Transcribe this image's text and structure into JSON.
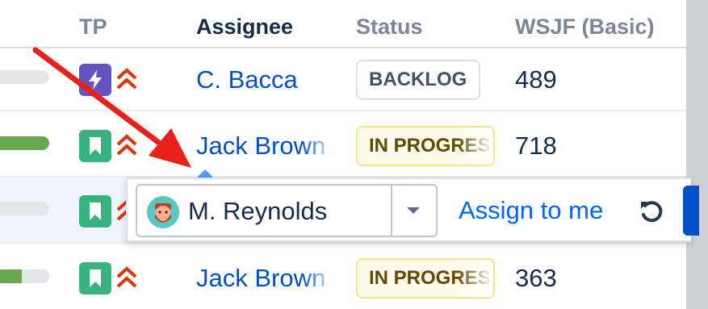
{
  "header": {
    "tp": "TP",
    "assignee": "Assignee",
    "status": "Status",
    "wsjf": "WSJF (Basic)"
  },
  "rows": [
    {
      "progress": 0.0,
      "type_icon": "lightning-icon",
      "priority_icon": "double-chevron-up-icon",
      "assignee": "C. Bacca",
      "status": "BACKLOG",
      "wsjf": "489"
    },
    {
      "progress": 1.0,
      "type_icon": "bookmark-icon",
      "priority_icon": "double-chevron-up-icon",
      "assignee": "Jack Brown",
      "status": "IN PROGRESS",
      "wsjf": "718"
    },
    {
      "progress": 0.0,
      "type_icon": "bookmark-icon",
      "priority_icon": "double-chevron-up-icon"
    },
    {
      "progress": 0.45,
      "type_icon": "bookmark-icon",
      "priority_icon": "double-chevron-up-icon",
      "assignee": "Jack Brown",
      "status": "IN PROGRESS",
      "wsjf": "363"
    }
  ],
  "popover": {
    "selected_assignee": "M. Reynolds",
    "avatar_icon": "bearded-man-avatar",
    "dropdown_icon": "caret-down-icon",
    "assign_to_me": "Assign to me",
    "undo_icon": "undo-icon"
  },
  "colors": {
    "link": "#0052cc",
    "epic": "#6554c0",
    "story": "#36b37e",
    "priority": "#de350b",
    "arrow": "#e8201a",
    "progress_fill": "#6aa84f"
  }
}
